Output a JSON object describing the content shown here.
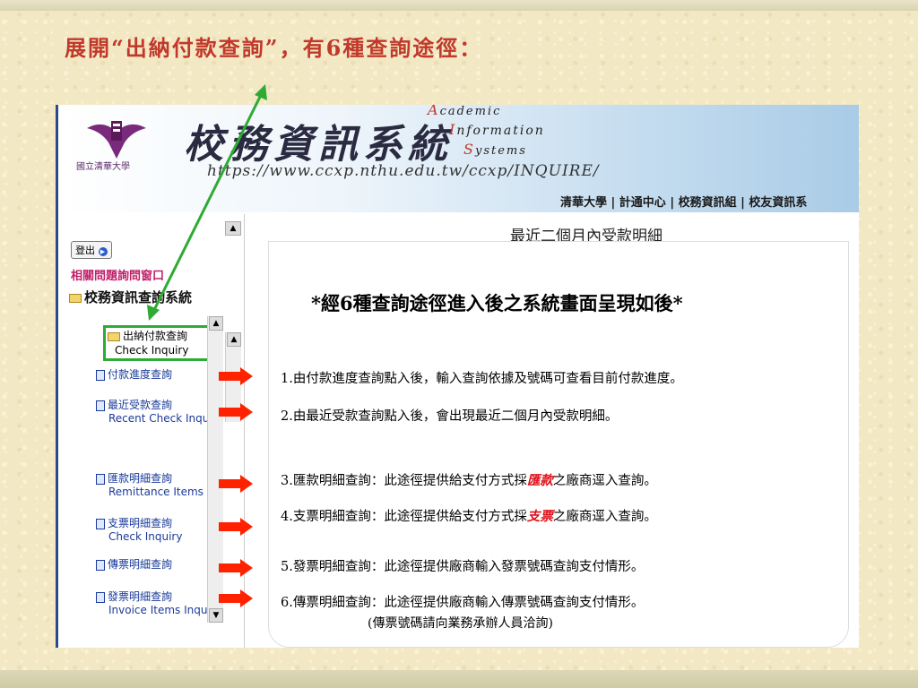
{
  "slide": {
    "title": "展開“出納付款查詢”，有6種查詢途徑："
  },
  "banner": {
    "school_name": "國立清華大學",
    "title_cn": "校務資訊系統",
    "title_en_line1": "cademic",
    "title_en_cap1": "A",
    "title_en_line2": "nformation",
    "title_en_cap2": "I",
    "title_en_line3": "ystems",
    "title_en_cap3": "S",
    "url": "https://www.ccxp.nthu.edu.tw/ccxp/INQUIRE/",
    "links": "清華大學 | 計通中心 | 校務資訊組 | 校友資訊系"
  },
  "sidebar": {
    "logout": "登出",
    "faq": "相關問題詢問窗口",
    "system": "校務資訊查詢系統"
  },
  "tree": {
    "root_cn": "出納付款查詢",
    "root_en": "Check Inquiry",
    "items": [
      {
        "cn": "付款進度查詢",
        "en": ""
      },
      {
        "cn": "最近受款查詢",
        "en": "Recent Check Inquiry"
      },
      {
        "cn": "匯款明細查詢",
        "en": "Remittance Items Inq"
      },
      {
        "cn": "支票明細查詢",
        "en": "Check Inquiry"
      },
      {
        "cn": "傳票明細查詢",
        "en": ""
      },
      {
        "cn": "發票明細查詢",
        "en": "Invoice Items Inquiry"
      }
    ]
  },
  "main": {
    "header": "最近二個月內受款明細",
    "panel_title": "*經6種查詢途徑進入後之系統畫面呈現如後*",
    "items": [
      "1.由付款進度查詢點入後，輸入查詢依據及號碼可查看目前付款進度。",
      "2.由最近受款查詢點入後，會出現最近二個月內受款明細。"
    ],
    "item3_pre": "3.匯款明細查詢：此途徑提供給支付方式採",
    "item3_em": "匯款",
    "item3_post": "之廠商逕入查詢。",
    "item4_pre": "4.支票明細查詢：此途徑提供給支付方式採",
    "item4_em": "支票",
    "item4_post": "之廠商逕入查詢。",
    "item5": "5.發票明細查詢：此途徑提供廠商輸入發票號碼查詢支付情形。",
    "item6": "6.傳票明細查詢：此途徑提供廠商輸入傳票號碼查詢支付情形。",
    "note": "(傳票號碼請向業務承辦人員洽詢)"
  },
  "colors": {
    "title": "#c0392b",
    "arrow": "#ff2200",
    "highlight_box": "#2eaa35",
    "emphasis": "#e0101a"
  }
}
